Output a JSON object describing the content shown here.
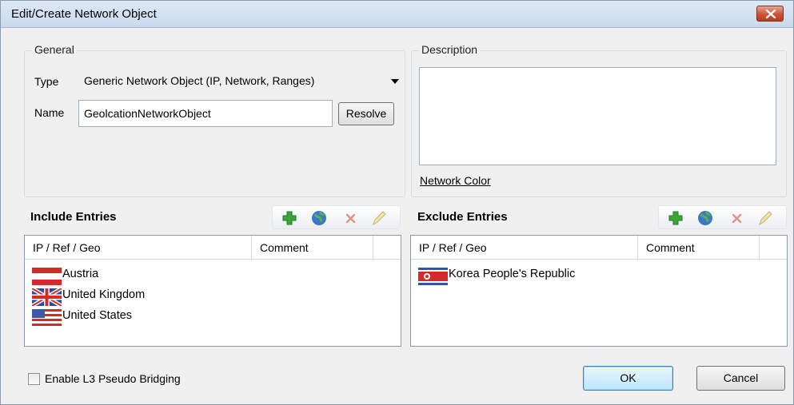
{
  "window": {
    "title": "Edit/Create Network Object",
    "close_icon": "close-icon"
  },
  "general": {
    "legend": "General",
    "type_label": "Type",
    "type_value": "Generic Network Object (IP, Network, Ranges)",
    "name_label": "Name",
    "name_value": "GeolcationNetworkObject",
    "resolve_label": "Resolve"
  },
  "description": {
    "legend": "Description",
    "value": "",
    "network_color_link": "Network Color"
  },
  "include": {
    "title": "Include Entries",
    "columns": [
      "IP / Ref / Geo",
      "Comment"
    ],
    "rows": [
      {
        "name": "Austria",
        "flag": "austria-flag-icon"
      },
      {
        "name": "United Kingdom",
        "flag": "uk-flag-icon"
      },
      {
        "name": "United States",
        "flag": "us-flag-icon"
      }
    ]
  },
  "exclude": {
    "title": "Exclude Entries",
    "columns": [
      "IP / Ref / Geo",
      "Comment"
    ],
    "rows": [
      {
        "name": "Korea People's Republic",
        "flag": "north-korea-flag-icon"
      }
    ]
  },
  "toolbar_icons": [
    "add-icon",
    "globe-icon",
    "delete-icon",
    "edit-icon"
  ],
  "footer": {
    "bridging_label": "Enable L3 Pseudo Bridging",
    "bridging_checked": false,
    "ok_label": "OK",
    "cancel_label": "Cancel"
  },
  "colors": {
    "titlebar": "#c9d9ec",
    "window_bg": "#f0f0f0",
    "close": "#c9543b",
    "add": "#3aa63a",
    "delete": "#e06666"
  }
}
